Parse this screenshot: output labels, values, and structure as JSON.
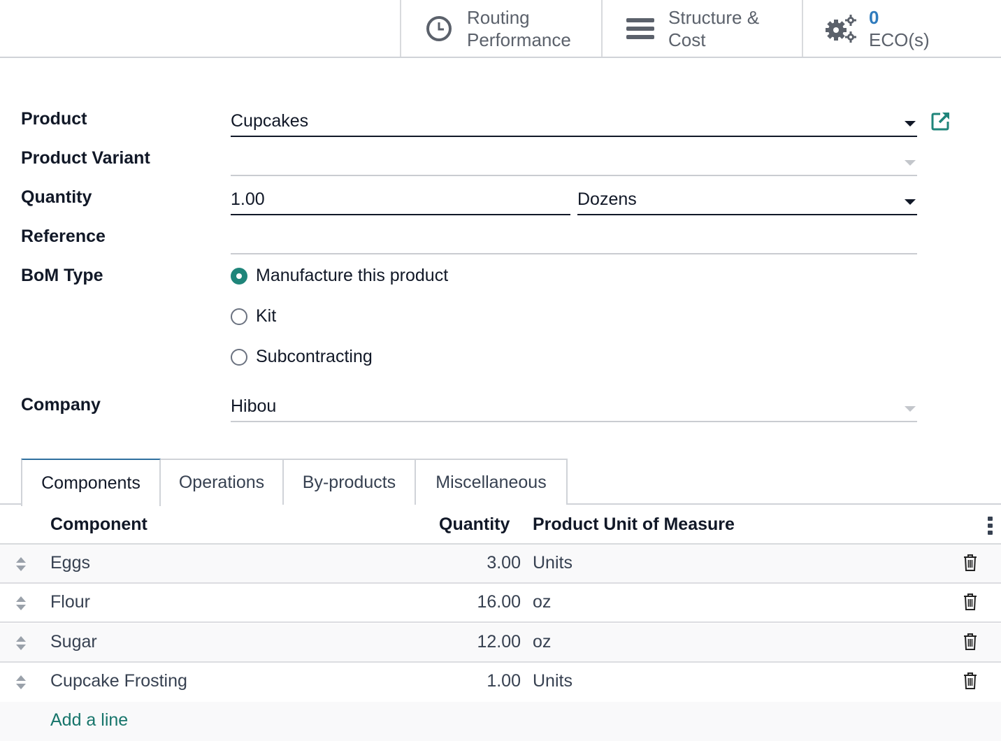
{
  "smart_buttons": {
    "routing": {
      "line1": "Routing",
      "line2": "Performance",
      "icon": "clock-icon"
    },
    "structure": {
      "line1": "Structure &",
      "line2": "Cost",
      "icon": "bars-icon"
    },
    "eco": {
      "count": "0",
      "label": "ECO(s)",
      "icon": "gears-icon"
    }
  },
  "form": {
    "product": {
      "label": "Product",
      "value": "Cupcakes"
    },
    "product_variant": {
      "label": "Product Variant",
      "value": ""
    },
    "quantity": {
      "label": "Quantity",
      "value": "1.00",
      "uom": "Dozens"
    },
    "reference": {
      "label": "Reference",
      "value": ""
    },
    "bom_type": {
      "label": "BoM Type",
      "options": [
        {
          "label": "Manufacture this product",
          "selected": true
        },
        {
          "label": "Kit",
          "selected": false
        },
        {
          "label": "Subcontracting",
          "selected": false
        }
      ]
    },
    "company": {
      "label": "Company",
      "value": "Hibou"
    }
  },
  "tabs": [
    {
      "label": "Components",
      "active": true
    },
    {
      "label": "Operations",
      "active": false
    },
    {
      "label": "By-products",
      "active": false
    },
    {
      "label": "Miscellaneous",
      "active": false
    }
  ],
  "table": {
    "headers": {
      "component": "Component",
      "quantity": "Quantity",
      "uom": "Product Unit of Measure"
    },
    "rows": [
      {
        "component": "Eggs",
        "quantity": "3.00",
        "uom": "Units"
      },
      {
        "component": "Flour",
        "quantity": "16.00",
        "uom": "oz"
      },
      {
        "component": "Sugar",
        "quantity": "12.00",
        "uom": "oz"
      },
      {
        "component": "Cupcake Frosting",
        "quantity": "1.00",
        "uom": "Units"
      }
    ],
    "add_line": "Add a line"
  },
  "colors": {
    "accent": "#1f857a",
    "link": "#17756b",
    "eco_count": "#2f7bbd",
    "tab_active_border": "#2f6f9f"
  }
}
